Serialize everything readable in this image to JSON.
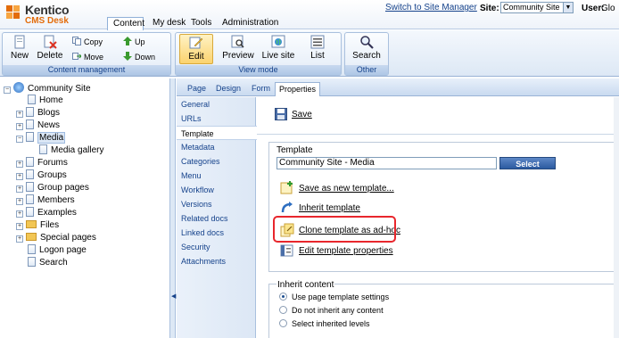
{
  "app": {
    "brand_name": "Kentico",
    "brand_sub": "CMS Desk"
  },
  "main_tabs": [
    "Content",
    "My desk",
    "Tools",
    "Administration"
  ],
  "header": {
    "switch_link": "Switch to Site Manager",
    "site_label": "Site:",
    "site_value": "Community Site",
    "user_label": "User:",
    "user_value": "Glo"
  },
  "toolbar": {
    "content_management": {
      "title": "Content management",
      "new": "New",
      "delete": "Delete",
      "copy": "Copy",
      "move": "Move",
      "up": "Up",
      "down": "Down"
    },
    "view_mode": {
      "title": "View mode",
      "edit": "Edit",
      "preview": "Preview",
      "live_site": "Live site",
      "list": "List"
    },
    "other": {
      "title": "Other",
      "search": "Search"
    }
  },
  "tree": {
    "root": "Community Site",
    "nodes": [
      "Home",
      "Blogs",
      "News",
      "Media",
      "Media gallery",
      "Forums",
      "Groups",
      "Group pages",
      "Members",
      "Examples",
      "Files",
      "Special pages",
      "Logon page",
      "Search"
    ]
  },
  "page_tabs": [
    "Page",
    "Design",
    "Form",
    "Properties"
  ],
  "side_menu": [
    "General",
    "URLs",
    "Template",
    "Metadata",
    "Categories",
    "Menu",
    "Workflow",
    "Versions",
    "Related docs",
    "Linked docs",
    "Security",
    "Attachments"
  ],
  "content": {
    "save": "Save",
    "template_legend": "Template",
    "template_value": "Community Site - Media",
    "select_button": "Select",
    "actions": {
      "save_new": "Save as new template...",
      "inherit": "Inherit template",
      "clone": "Clone template as ad-hoc",
      "edit": "Edit template properties"
    },
    "inherit_legend": "Inherit content",
    "radios": [
      "Use page template settings",
      "Do not inherit any content",
      "Select inherited levels"
    ]
  },
  "colors": {
    "accent": "#15428b",
    "highlight": "#e8262c",
    "select_button": "#2c5aa0"
  }
}
